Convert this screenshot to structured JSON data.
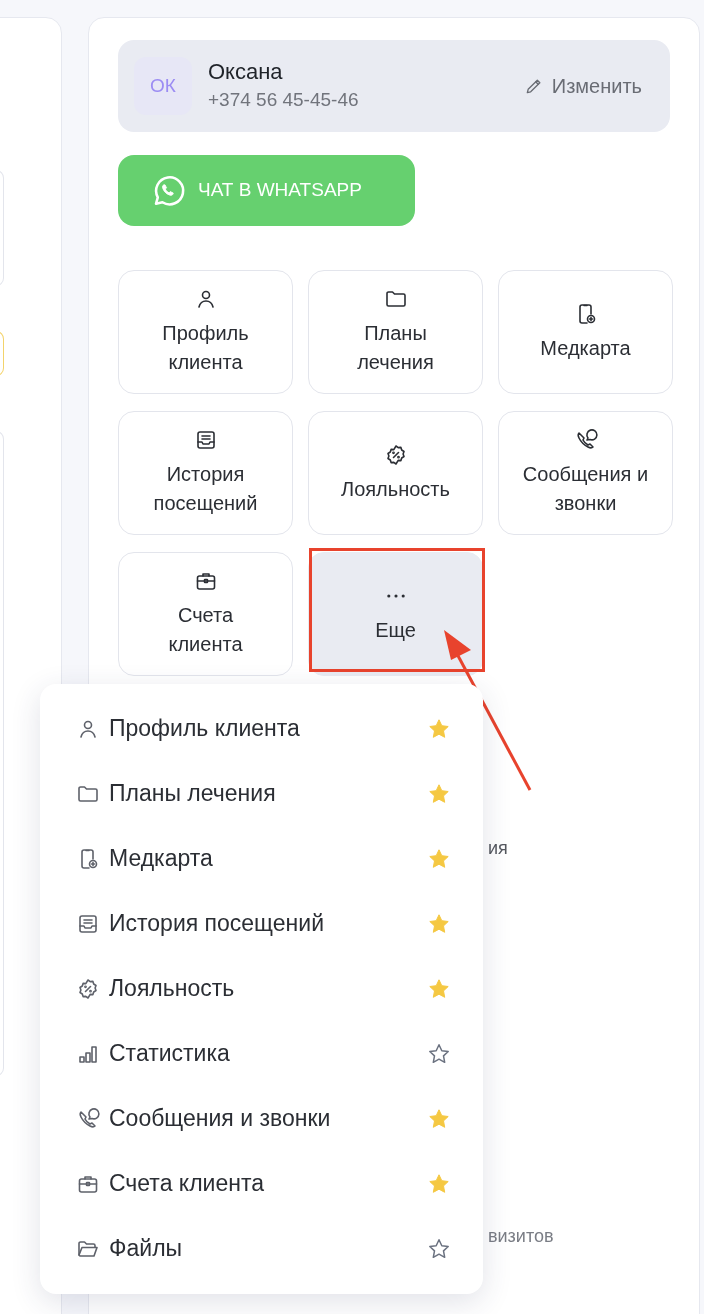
{
  "contact": {
    "initials": "ОК",
    "name": "Оксана",
    "phone": "+374 56 45-45-46",
    "edit_label": "Изменить"
  },
  "whatsapp_button": {
    "label": "ЧАТ В WHATSAPP"
  },
  "tiles": [
    {
      "label": "Профиль клиента",
      "selected": false
    },
    {
      "label": "Планы лечения",
      "selected": false
    },
    {
      "label": "Медкарта",
      "selected": false
    },
    {
      "label": "История посещений",
      "selected": false
    },
    {
      "label": "Лояльность",
      "selected": false
    },
    {
      "label": "Сообщения и звонки",
      "selected": false
    },
    {
      "label": "Счета клиента",
      "selected": false
    },
    {
      "label": "Еще",
      "selected": true
    }
  ],
  "background_texts": [
    "ия",
    "визитов"
  ],
  "menu": [
    {
      "label": "Профиль клиента",
      "starred": true
    },
    {
      "label": "Планы лечения",
      "starred": true
    },
    {
      "label": "Медкарта",
      "starred": true
    },
    {
      "label": "История посещений",
      "starred": true
    },
    {
      "label": "Лояльность",
      "starred": true
    },
    {
      "label": "Статистика",
      "starred": false
    },
    {
      "label": "Сообщения и звонки",
      "starred": true
    },
    {
      "label": "Счета клиента",
      "starred": true
    },
    {
      "label": "Файлы",
      "starred": false
    }
  ]
}
